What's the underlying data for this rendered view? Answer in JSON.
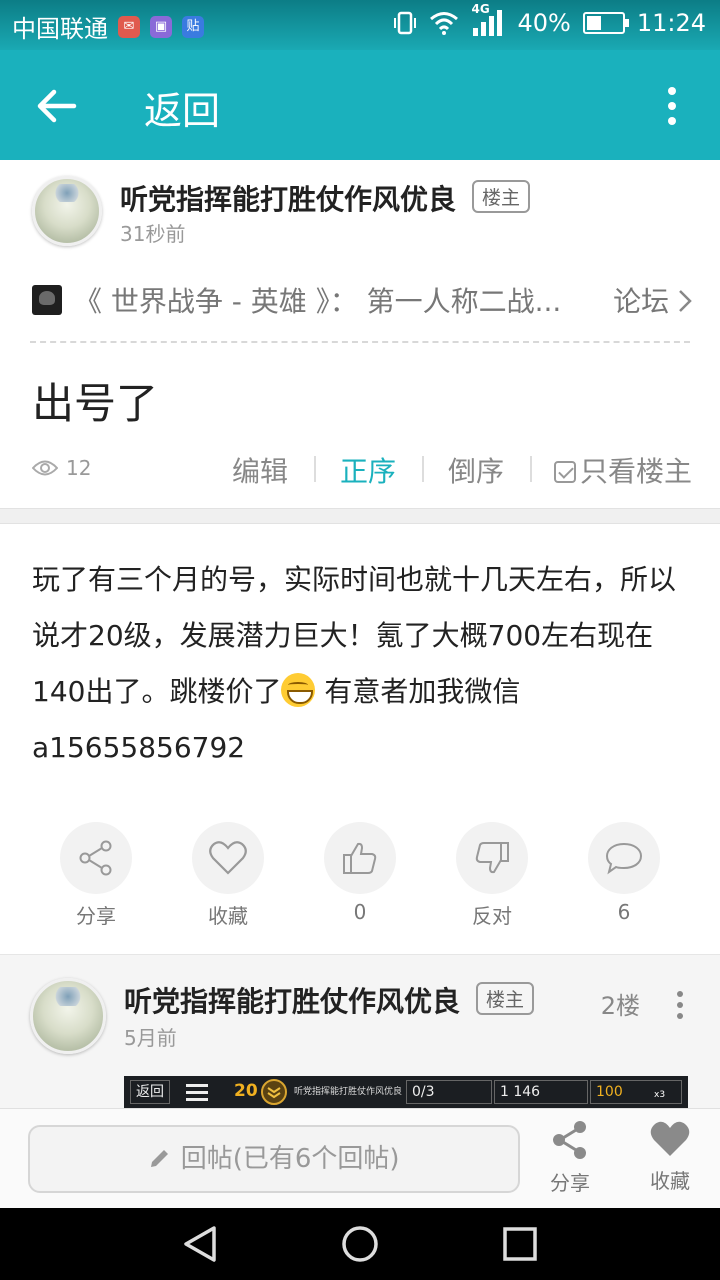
{
  "status_bar": {
    "carrier": "中国联通",
    "network": "4G",
    "battery_text": "40%",
    "battery_level": 0.4,
    "time": "11:24"
  },
  "app_bar": {
    "title": "返回"
  },
  "post": {
    "author": "听党指挥能打胜仗作风优良",
    "badge": "楼主",
    "time": "31秒前",
    "forum_title": "《 世界战争 - 英雄 》： 第一人称二战...",
    "forum_link": "论坛",
    "title": "出号了",
    "views": "12",
    "sort": {
      "edit": "编辑",
      "asc": "正序",
      "desc": "倒序",
      "owner_only": "只看楼主"
    },
    "body_part1": "玩了有三个月的号，实际时间也就十几天左右，所以说才20级，发展潜力巨大！氪了大概700左右现在140出了。跳楼价了",
    "body_part2": " 有意者加我微信 a15655856792",
    "actions": {
      "share": "分享",
      "favorite": "收藏",
      "like_count": "0",
      "oppose": "反对",
      "comment_count": "6"
    }
  },
  "reply": {
    "author": "听党指挥能打胜仗作风优良",
    "badge": "楼主",
    "time": "5月前",
    "floor": "2楼",
    "game_strip": {
      "back": "返回",
      "level": "20",
      "name": "听党指挥能打胜仗作风优良",
      "tanks": "0/3",
      "silver": "1 146",
      "gold": "100",
      "multiplier": "x3"
    }
  },
  "bottom_bar": {
    "reply_placeholder": "回帖(已有6个回帖)",
    "share": "分享",
    "favorite": "收藏"
  },
  "colors": {
    "accent": "#1ab1bd",
    "status_bar": "#14969f",
    "active_sort": "#1ab1bd"
  }
}
